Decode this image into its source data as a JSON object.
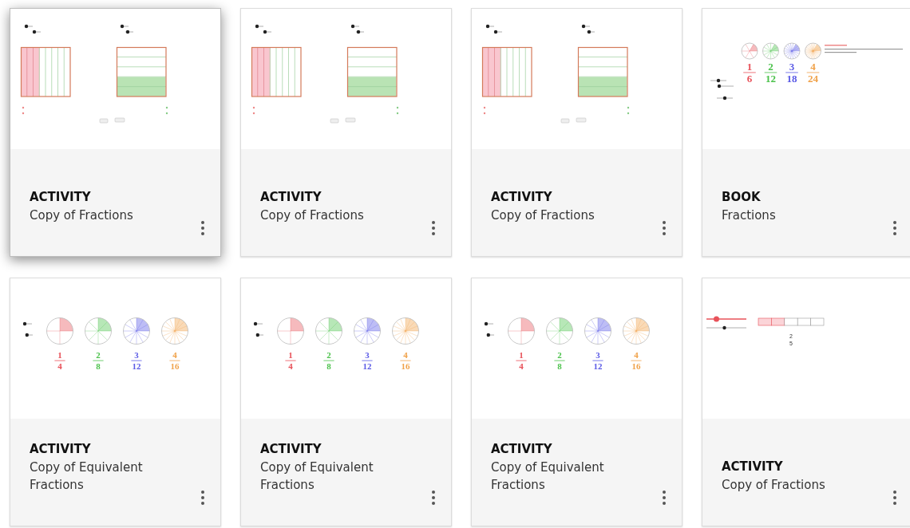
{
  "cards": [
    {
      "type": "ACTIVITY",
      "title": "Copy of Fractions",
      "selected": true,
      "preview": {
        "kind": "area-model"
      }
    },
    {
      "type": "ACTIVITY",
      "title": "Copy of Fractions",
      "selected": false,
      "preview": {
        "kind": "area-model"
      }
    },
    {
      "type": "ACTIVITY",
      "title": "Copy of Fractions",
      "selected": false,
      "preview": {
        "kind": "area-model"
      }
    },
    {
      "type": "BOOK",
      "title": "Fractions",
      "selected": false,
      "preview": {
        "kind": "circles-small",
        "fractions": [
          {
            "numerator": "1",
            "denominator": "6",
            "color": "#e8525a"
          },
          {
            "numerator": "2",
            "denominator": "12",
            "color": "#4cc24c"
          },
          {
            "numerator": "3",
            "denominator": "18",
            "color": "#5a5ae6"
          },
          {
            "numerator": "4",
            "denominator": "24",
            "color": "#f0a24a"
          }
        ]
      }
    },
    {
      "type": "ACTIVITY",
      "title": "Copy of Equivalent Fractions",
      "selected": false,
      "preview": {
        "kind": "circles",
        "fractions": [
          {
            "numerator": "1",
            "denominator": "4",
            "color": "#e8525a"
          },
          {
            "numerator": "2",
            "denominator": "8",
            "color": "#4cc24c"
          },
          {
            "numerator": "3",
            "denominator": "12",
            "color": "#5a5ae6"
          },
          {
            "numerator": "4",
            "denominator": "16",
            "color": "#f0a24a"
          }
        ]
      }
    },
    {
      "type": "ACTIVITY",
      "title": "Copy of Equivalent Fractions",
      "selected": false,
      "preview": {
        "kind": "circles",
        "fractions": [
          {
            "numerator": "1",
            "denominator": "4",
            "color": "#e8525a"
          },
          {
            "numerator": "2",
            "denominator": "8",
            "color": "#4cc24c"
          },
          {
            "numerator": "3",
            "denominator": "12",
            "color": "#5a5ae6"
          },
          {
            "numerator": "4",
            "denominator": "16",
            "color": "#f0a24a"
          }
        ]
      }
    },
    {
      "type": "ACTIVITY",
      "title": "Copy of Equivalent Fractions",
      "selected": false,
      "preview": {
        "kind": "circles",
        "fractions": [
          {
            "numerator": "1",
            "denominator": "4",
            "color": "#e8525a"
          },
          {
            "numerator": "2",
            "denominator": "8",
            "color": "#4cc24c"
          },
          {
            "numerator": "3",
            "denominator": "12",
            "color": "#5a5ae6"
          },
          {
            "numerator": "4",
            "denominator": "16",
            "color": "#f0a24a"
          }
        ]
      }
    },
    {
      "type": "ACTIVITY",
      "title": "Copy of Fractions",
      "selected": false,
      "preview": {
        "kind": "bar",
        "fraction": {
          "numerator": "2",
          "denominator": "5",
          "color": "#e8525a"
        }
      }
    }
  ]
}
